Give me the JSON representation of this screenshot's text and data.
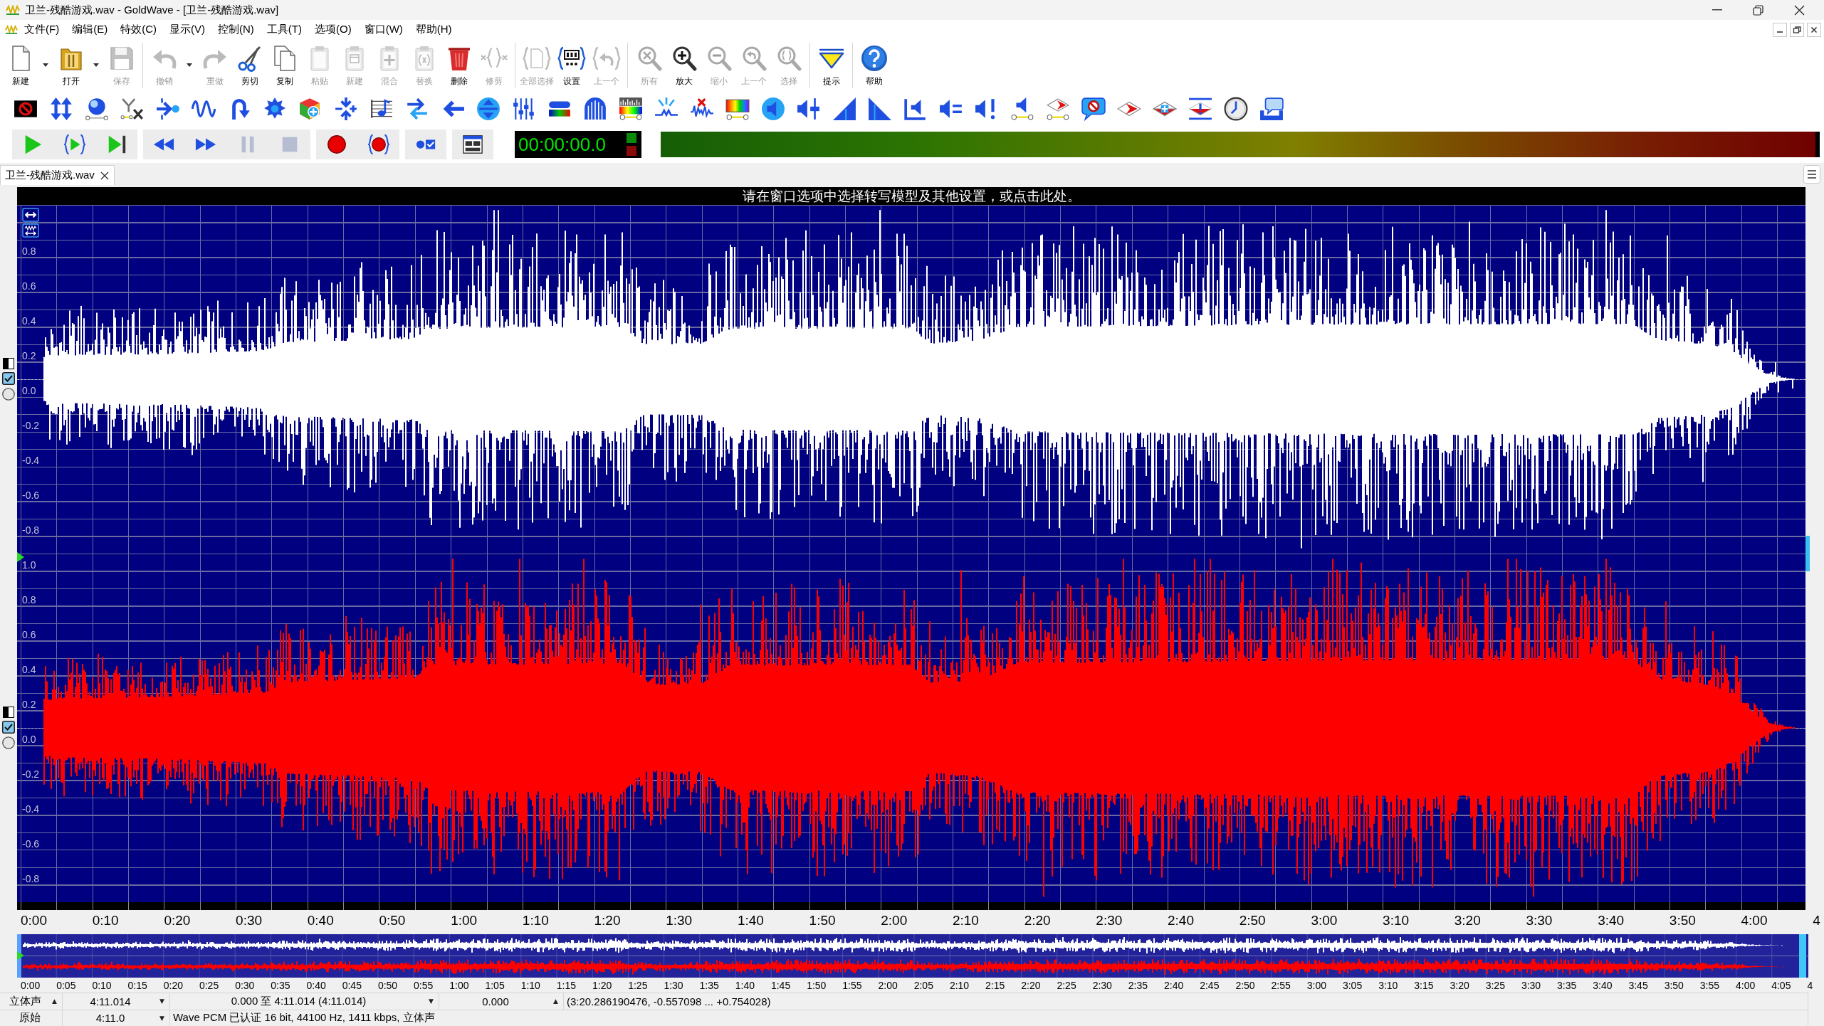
{
  "window": {
    "title": "卫兰-残酷游戏.wav - GoldWave - [卫兰-残酷游戏.wav]"
  },
  "menu_bar": {
    "items": [
      "文件(F)",
      "编辑(E)",
      "特效(C)",
      "显示(V)",
      "控制(N)",
      "工具(T)",
      "选项(O)",
      "窗口(W)",
      "帮助(H)"
    ]
  },
  "toolbar": {
    "groups": [
      [
        {
          "label": "新建",
          "disabled": false,
          "dropdown": true
        },
        {
          "label": "打开",
          "disabled": false,
          "dropdown": true
        },
        {
          "label": "保存",
          "disabled": true,
          "dropdown": false
        }
      ],
      [
        {
          "label": "撤销",
          "disabled": true,
          "dropdown": true
        },
        {
          "label": "重做",
          "disabled": true,
          "dropdown": false
        },
        {
          "label": "剪切",
          "disabled": false,
          "dropdown": false
        },
        {
          "label": "复制",
          "disabled": false,
          "dropdown": false
        },
        {
          "label": "粘贴",
          "disabled": true,
          "dropdown": false
        },
        {
          "label": "新建",
          "disabled": true,
          "dropdown": false
        },
        {
          "label": "混合",
          "disabled": true,
          "dropdown": false
        },
        {
          "label": "替换",
          "disabled": true,
          "dropdown": false
        },
        {
          "label": "删除",
          "disabled": false,
          "dropdown": false
        },
        {
          "label": "修剪",
          "disabled": true,
          "dropdown": false
        }
      ],
      [
        {
          "label": "全部选择",
          "disabled": true,
          "dropdown": false
        },
        {
          "label": "设置",
          "disabled": false,
          "dropdown": false
        },
        {
          "label": "上一个",
          "disabled": true,
          "dropdown": false
        }
      ],
      [
        {
          "label": "所有",
          "disabled": true,
          "dropdown": false
        },
        {
          "label": "放大",
          "disabled": false,
          "dropdown": false
        },
        {
          "label": "缩小",
          "disabled": true,
          "dropdown": false
        },
        {
          "label": "上一个",
          "disabled": true,
          "dropdown": false
        },
        {
          "label": "选择",
          "disabled": true,
          "dropdown": false
        }
      ],
      [
        {
          "label": "提示",
          "disabled": false,
          "dropdown": false
        }
      ],
      [
        {
          "label": "帮助",
          "disabled": false,
          "dropdown": false
        }
      ]
    ]
  },
  "transport": {
    "groups": [
      [
        {
          "disabled": false
        },
        {
          "disabled": false
        },
        {
          "disabled": false
        }
      ],
      [
        {
          "disabled": false
        },
        {
          "disabled": false
        },
        {
          "disabled": true
        },
        {
          "disabled": true
        }
      ],
      [
        {
          "disabled": false
        },
        {
          "disabled": false
        }
      ],
      [
        {
          "disabled": false
        }
      ],
      [
        {
          "disabled": false
        }
      ]
    ],
    "time_display": "00:00:00.0"
  },
  "tabs": [
    {
      "label": "卫兰-残酷游戏.wav",
      "selected": true
    }
  ],
  "notice": "请在窗口选项中选择转写模型及其他设置，或点击此处。",
  "channels": [
    {
      "color": "#ffffff",
      "checked": true,
      "selected": false,
      "axis_labels": [
        "0.8",
        "0.6",
        "0.4",
        "0.2",
        "0.0",
        "-0.2",
        "-0.4",
        "-0.6",
        "-0.8"
      ]
    },
    {
      "color": "#ff0000",
      "checked": true,
      "selected": false,
      "axis_labels": [
        "1.0",
        "0.8",
        "0.6",
        "0.4",
        "0.2",
        "0.0",
        "-0.2",
        "-0.4",
        "-0.6",
        "-0.8"
      ]
    }
  ],
  "time_ruler": {
    "labels": [
      "0:00",
      "0:10",
      "0:20",
      "0:30",
      "0:40",
      "0:50",
      "1:00",
      "1:10",
      "1:20",
      "1:30",
      "1:40",
      "1:50",
      "2:00",
      "2:10",
      "2:20",
      "2:30",
      "2:40",
      "2:50",
      "3:00",
      "3:10",
      "3:20",
      "3:30",
      "3:40",
      "3:50",
      "4:00",
      "4"
    ]
  },
  "overview": {
    "time_labels": [
      "0:00",
      "0:05",
      "0:10",
      "0:15",
      "0:20",
      "0:25",
      "0:30",
      "0:35",
      "0:40",
      "0:45",
      "0:50",
      "0:55",
      "1:00",
      "1:05",
      "1:10",
      "1:15",
      "1:20",
      "1:25",
      "1:30",
      "1:35",
      "1:40",
      "1:45",
      "1:50",
      "1:55",
      "2:00",
      "2:05",
      "2:10",
      "2:15",
      "2:20",
      "2:25",
      "2:30",
      "2:35",
      "2:40",
      "2:45",
      "2:50",
      "2:55",
      "3:00",
      "3:05",
      "3:10",
      "3:15",
      "3:20",
      "3:25",
      "3:30",
      "3:35",
      "3:40",
      "3:45",
      "3:50",
      "3:55",
      "4:00",
      "4:05",
      "4"
    ]
  },
  "status_bar": {
    "rows": [
      [
        {
          "text": "立体声",
          "caret": "▲"
        },
        {
          "text": "4:11.014",
          "caret": "▼"
        },
        {
          "text": "0.000 至 4:11.014 (4:11.014)",
          "caret": "▼"
        },
        {
          "text": "0.000",
          "caret": "▲"
        },
        {
          "text": "(3:20.286190476, -0.557098 ... +0.754028)"
        }
      ],
      [
        {
          "text": "原始"
        },
        {
          "text": "4:11.0",
          "caret": "▼"
        },
        {
          "text": "Wave PCM 已认证 16 bit, 44100 Hz, 1411 kbps, 立体声"
        }
      ]
    ]
  }
}
